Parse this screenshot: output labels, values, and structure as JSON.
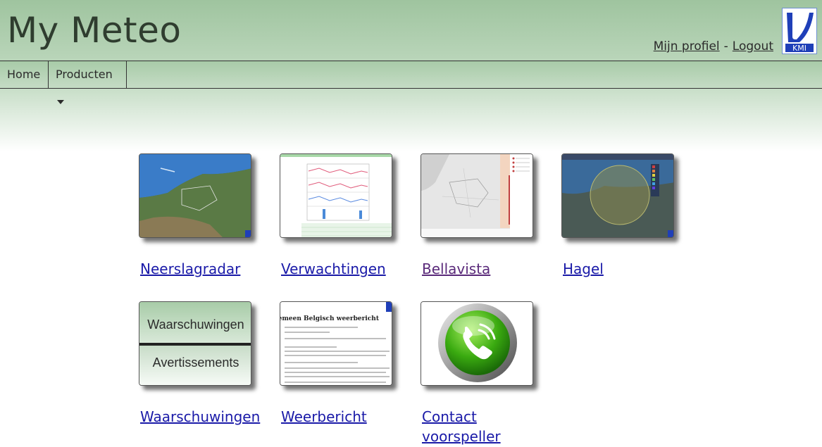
{
  "header": {
    "app_title": "My Meteo",
    "profile_link": "Mijn profiel",
    "separator": "-",
    "logout_link": "Logout",
    "logo_text": "KMI"
  },
  "nav": {
    "home": "Home",
    "products": "Producten"
  },
  "tiles": [
    {
      "label": "Neerslagradar",
      "icon": "radar-map-icon"
    },
    {
      "label": "Verwachtingen",
      "icon": "forecast-charts-icon"
    },
    {
      "label": "Bellavista",
      "icon": "bellavista-map-icon"
    },
    {
      "label": "Hagel",
      "icon": "hail-map-icon"
    },
    {
      "label": "Waarschuwingen",
      "icon": "warnings-icon",
      "thumb_top": "Waarschuwingen",
      "thumb_bottom": "Avertissements"
    },
    {
      "label": "Weerbericht",
      "icon": "weather-report-icon",
      "thumb_heading": "Algemeen Belgisch weerbericht"
    },
    {
      "label_line1": "Contact",
      "label_line2": "voorspeller",
      "icon": "phone-icon"
    }
  ],
  "colors": {
    "link": "#1a1aa8",
    "visited_link": "#5a2a7a",
    "header_green": "#9fc49f"
  }
}
